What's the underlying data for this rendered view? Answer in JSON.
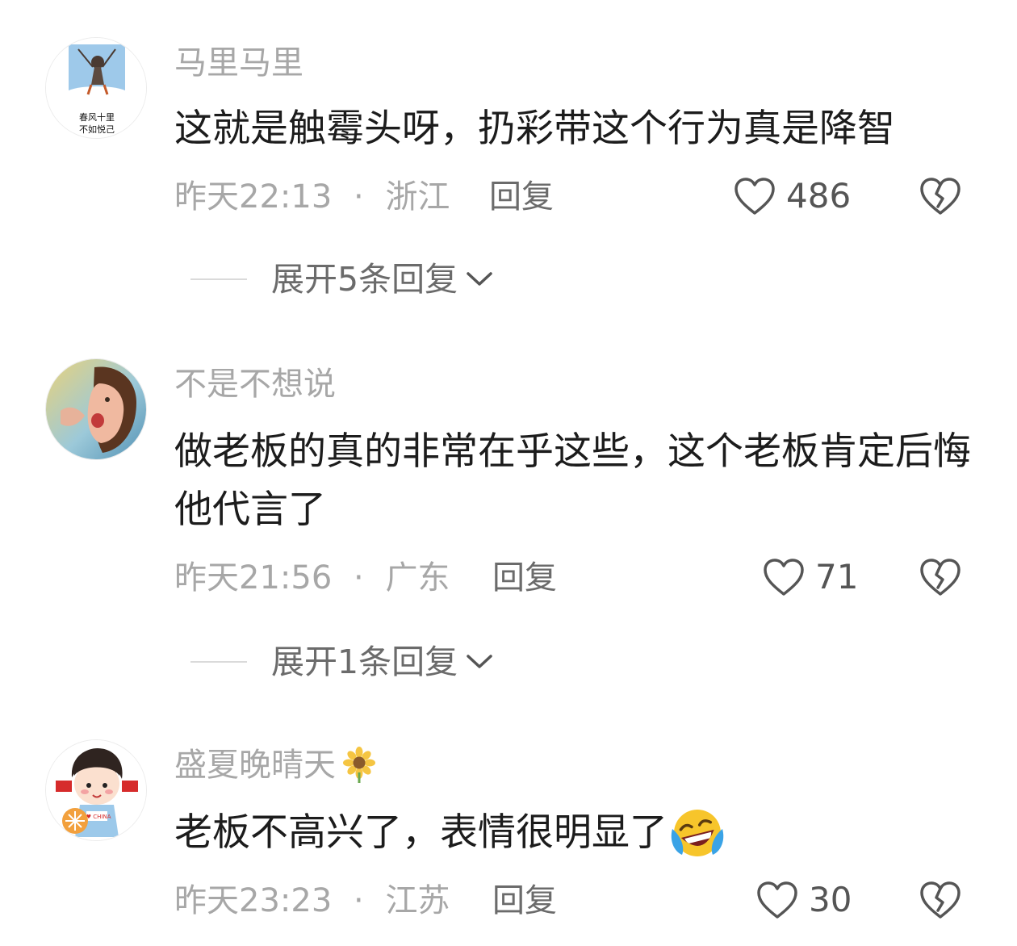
{
  "comments": [
    {
      "username": "马里马里",
      "text": "这就是触霉头呀，扔彩带这个行为真是降智",
      "time": "昨天22:13",
      "separator": "·",
      "location": "浙江",
      "reply_label": "回复",
      "likes": "486",
      "avatar_text_1": "春风十里",
      "avatar_text_2": "不如悦己",
      "expand_label": "展开5条回复"
    },
    {
      "username": "不是不想说",
      "text": "做老板的真的非常在乎这些，这个老板肯定后悔他代言了",
      "time": "昨天21:56",
      "separator": "·",
      "location": "广东",
      "reply_label": "回复",
      "likes": "71",
      "expand_label": "展开1条回复"
    },
    {
      "username": "盛夏晚晴天",
      "username_emoji": "sunflower-emoji",
      "text": "老板不高兴了，表情很明显了",
      "text_emoji": "laughing-crying-emoji",
      "time": "昨天23:23",
      "separator": "·",
      "location": "江苏",
      "reply_label": "回复",
      "likes": "30",
      "avatar_badge": "I ♥ CHINA"
    }
  ],
  "icons": {
    "like": "heart-outline-icon",
    "dislike": "broken-heart-icon",
    "expand": "chevron-down-icon"
  },
  "colors": {
    "text_primary": "#1c1c1c",
    "text_secondary": "#a7a7a7",
    "text_action": "#6b6b6b",
    "divider": "#dadada"
  }
}
